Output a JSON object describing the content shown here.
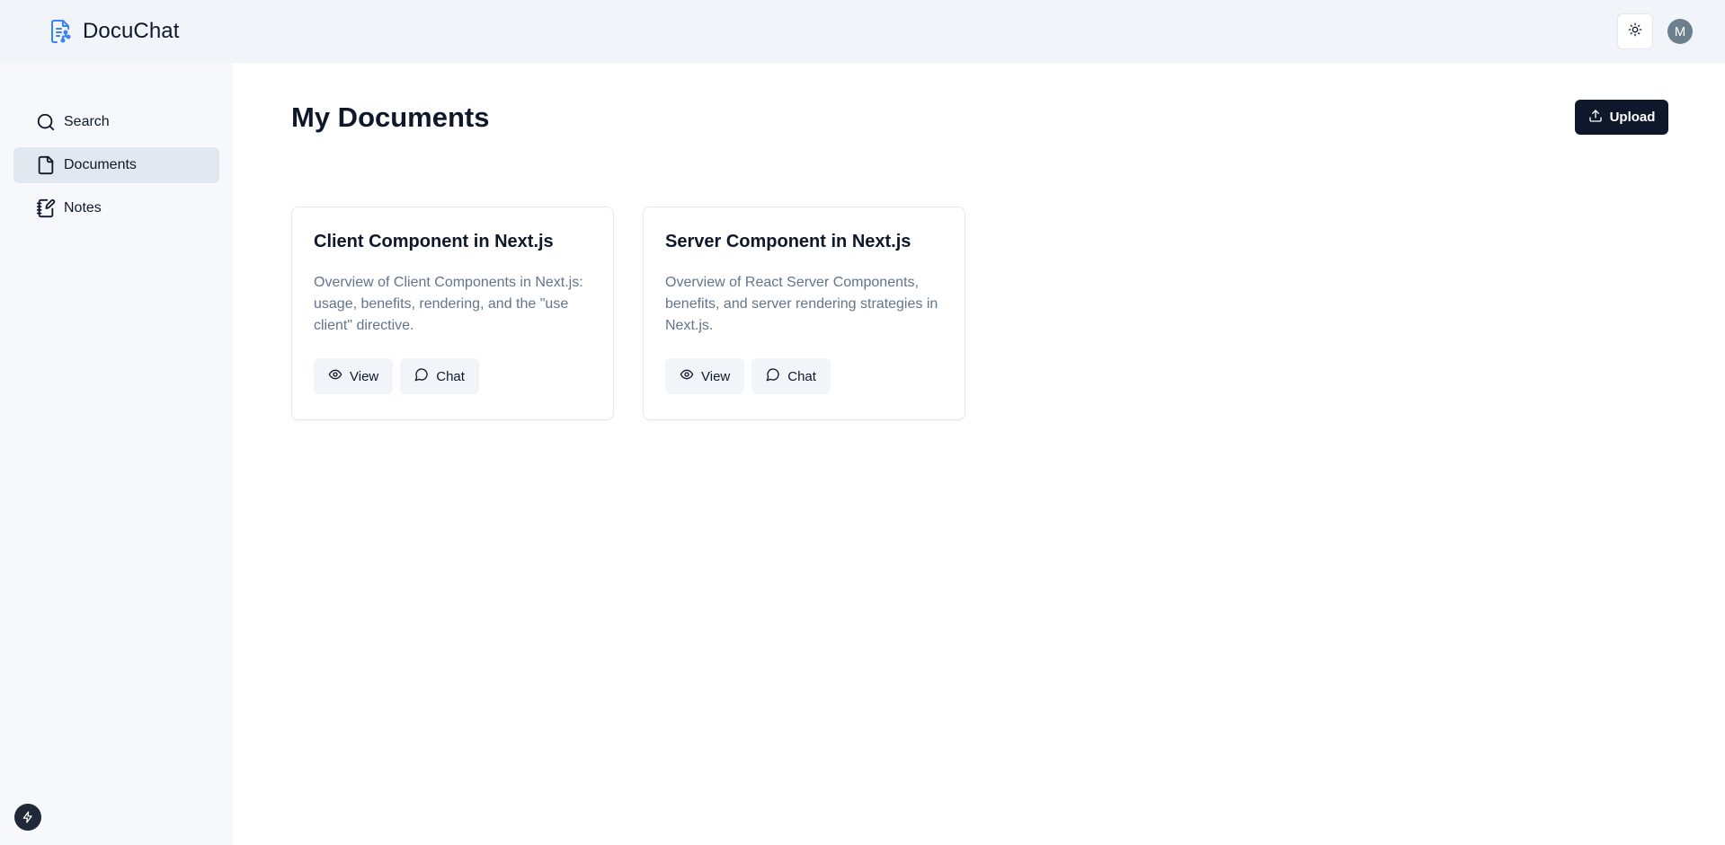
{
  "app": {
    "name": "DocuChat"
  },
  "header": {
    "theme_toggle_icon": "sun-icon",
    "avatar_initial": "M"
  },
  "sidebar": {
    "items": [
      {
        "label": "Search",
        "icon": "search-icon",
        "active": false
      },
      {
        "label": "Documents",
        "icon": "document-icon",
        "active": true
      },
      {
        "label": "Notes",
        "icon": "notebook-pen-icon",
        "active": false
      }
    ]
  },
  "main": {
    "title": "My Documents",
    "upload_label": "Upload",
    "documents": [
      {
        "title": "Client Component in Next.js",
        "description": "Overview of Client Components in Next.js: usage, benefits, rendering, and the \"use client\" directive.",
        "view_label": "View",
        "chat_label": "Chat"
      },
      {
        "title": "Server Component in Next.js",
        "description": "Overview of React Server Components, benefits, and server rendering strategies in Next.js.",
        "view_label": "View",
        "chat_label": "Chat"
      }
    ]
  },
  "colors": {
    "accent": "#3b82f6",
    "primary_button": "#0f172a",
    "muted_text": "#64748b"
  }
}
